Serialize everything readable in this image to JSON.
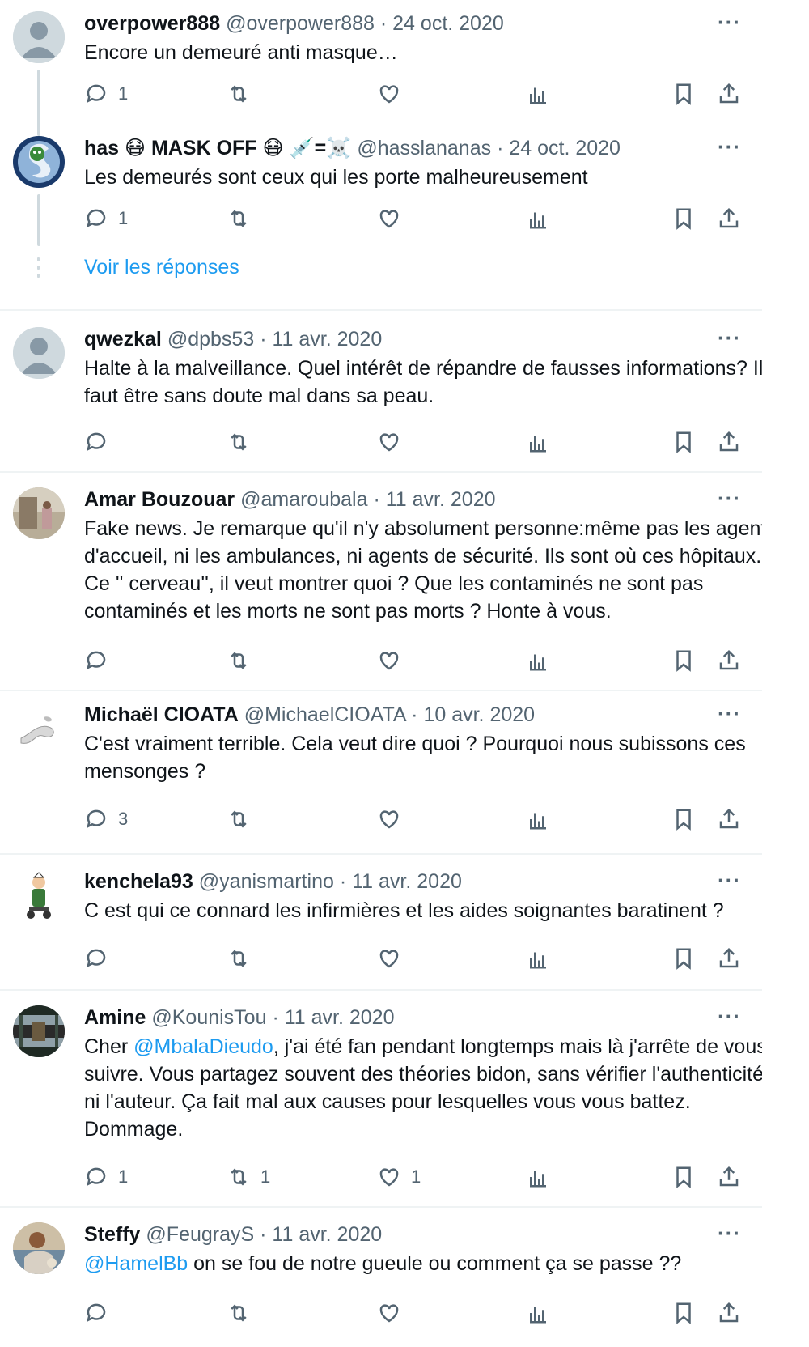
{
  "tweets": [
    {
      "name": "overpower888",
      "handle": "@overpower888",
      "date": "24 oct. 2020",
      "text": "Encore un demeuré anti masque…",
      "reply_count": "1",
      "retweet_count": "",
      "like_count": ""
    },
    {
      "name": "has 😷 MASK OFF 😷 💉=☠️",
      "handle": "@hasslananas",
      "date": "24 oct. 2020",
      "text": "Les demeurés sont ceux qui les porte malheureusement",
      "reply_count": "1",
      "retweet_count": "",
      "like_count": ""
    },
    {
      "name": "qwezkal",
      "handle": "@dpbs53",
      "date": "11 avr. 2020",
      "text": "Halte à la malveillance. Quel intérêt de répandre de fausses informations? Il faut être sans doute mal dans sa peau.",
      "reply_count": "",
      "retweet_count": "",
      "like_count": ""
    },
    {
      "name": "Amar Bouzouar",
      "handle": "@amaroubala",
      "date": "11 avr. 2020",
      "text": "Fake news. Je remarque qu'il n'y absolument personne:même pas les agents d'accueil, ni les ambulances, ni agents de sécurité. Ils sont où ces hôpitaux. Ce '' cerveau'', il veut montrer quoi ? Que les contaminés ne sont pas contaminés et les morts ne sont pas morts ? Honte à vous.",
      "reply_count": "",
      "retweet_count": "",
      "like_count": ""
    },
    {
      "name": "Michaël CIOATA",
      "handle": "@MichaelCIOATA",
      "date": "10 avr. 2020",
      "text": "C'est vraiment terrible. Cela veut dire quoi ? Pourquoi nous subissons ces mensonges ?",
      "reply_count": "3",
      "retweet_count": "",
      "like_count": ""
    },
    {
      "name": "kenchela93",
      "handle": "@yanismartino",
      "date": "11 avr. 2020",
      "text": "C est qui ce connard les infirmières et les aides soignantes baratinent ?",
      "reply_count": "",
      "retweet_count": "",
      "like_count": ""
    },
    {
      "name": "Amine",
      "handle": "@KounisTou",
      "date": "11 avr. 2020",
      "mention": "@MbalaDieudo",
      "text": ", j'ai été fan pendant longtemps mais là j'arrête de vous suivre. Vous partagez souvent des théories bidon, sans vérifier l'authenticité, ni l'auteur. Ça fait mal aux causes pour lesquelles vous vous battez. Dommage.",
      "text_prefix": "Cher ",
      "reply_count": "1",
      "retweet_count": "1",
      "like_count": "1"
    },
    {
      "name": "Steffy",
      "handle": "@FeugrayS",
      "date": "11 avr. 2020",
      "mention": "@HamelBb",
      "text": " on se fou de notre gueule ou comment ça se passe ??",
      "reply_count": "",
      "retweet_count": "",
      "like_count": ""
    }
  ],
  "see_replies": "Voir les réponses",
  "sep_dot": "·",
  "more_label": "···",
  "colors": {
    "link": "#1d9bf0",
    "muted": "#536471",
    "text": "#0f1419",
    "separator": "#eff3f4"
  },
  "icons": [
    "reply-icon",
    "retweet-icon",
    "like-icon",
    "views-icon",
    "bookmark-icon",
    "share-icon",
    "more-icon"
  ]
}
